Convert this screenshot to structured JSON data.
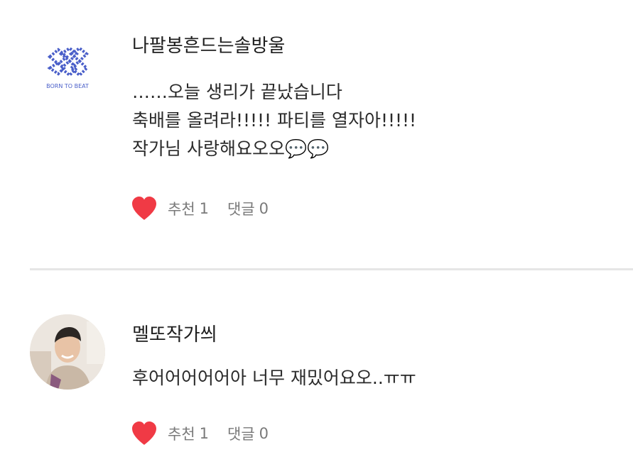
{
  "comments": [
    {
      "avatar_text": "BORN TO BEAT",
      "username": "나팔봉흔드는솔방울",
      "lines": [
        "……오늘 생리가 끝났습니다",
        "축배를 올려라!!!!! 파티를 열자아!!!!!",
        "작가님 사랑해요오오💬💬"
      ],
      "like_label": "추천",
      "like_count": "1",
      "reply_label": "댓글",
      "reply_count": "0"
    },
    {
      "username": "멜또작가씌",
      "lines": [
        "후어어어어어아 너무 재밌어요오..ㅠㅠ"
      ],
      "like_label": "추천",
      "like_count": "1",
      "reply_label": "댓글",
      "reply_count": "0"
    }
  ],
  "colors": {
    "heart": "#f03a45",
    "logo": "#4a5fc9",
    "divider": "#e6e6e6",
    "meta_text": "#7a7a7a"
  },
  "icons": [
    "heart-icon",
    "born-to-beat-logo",
    "user-photo-avatar"
  ]
}
